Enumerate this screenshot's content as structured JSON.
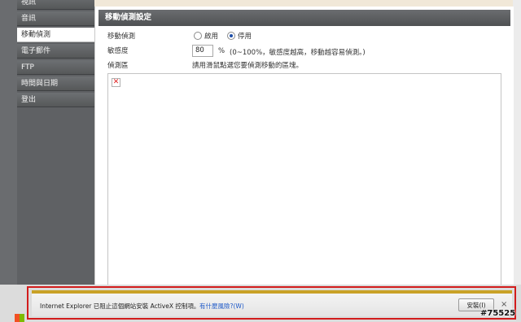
{
  "sidebar": {
    "items": [
      {
        "label": "視訊"
      },
      {
        "label": "音訊"
      },
      {
        "label": "移動偵測"
      },
      {
        "label": "電子郵件"
      },
      {
        "label": "FTP"
      },
      {
        "label": "時間與日期"
      },
      {
        "label": "登出"
      }
    ],
    "active_index": 2
  },
  "panel": {
    "title": "移動偵測設定",
    "motion_label": "移動偵測",
    "enable_label": "啟用",
    "disable_label": "停用",
    "selected": "停用",
    "sensitivity_label": "敏感度",
    "sensitivity_value": "80",
    "sensitivity_unit": "%",
    "sensitivity_hint": "(0~100%，敏感度越高，移動越容易偵測。)",
    "zone_label": "偵測區",
    "zone_hint": "請用滑鼠點選您要偵測移動的區塊。"
  },
  "infobar": {
    "message": "Internet Explorer 已阻止這個網站安裝 ActiveX 控制項。",
    "link": "有什麼風險?(W)",
    "install_button": "安裝(I)",
    "close": "×"
  },
  "watermark": "#75525",
  "colors": {
    "accent_border": "#d21c1c",
    "infobar_stripe": "#c9a227",
    "sidebar": "#5f6164"
  }
}
